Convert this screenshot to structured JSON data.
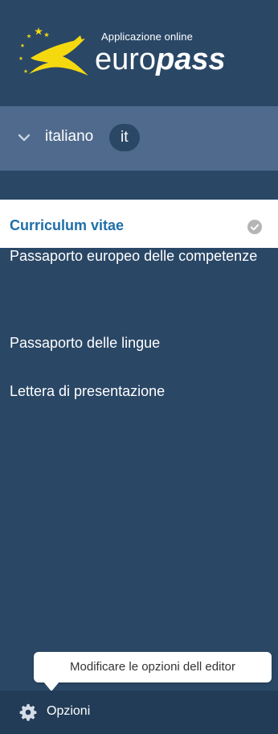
{
  "logo": {
    "subtitle": "Applicazione online",
    "name_light": "euro",
    "name_bold": "pass",
    "icon": "europass-logo"
  },
  "language": {
    "name": "italiano",
    "code": "it",
    "icon": "chevron-down-icon"
  },
  "menu": {
    "active": {
      "label": "Curriculum vitae",
      "status_icon": "check-circle-icon"
    },
    "items": [
      {
        "label": "Passaporto europeo delle competenze"
      },
      {
        "label": "Passaporto delle lingue"
      },
      {
        "label": "Lettera di presentazione"
      }
    ]
  },
  "footer": {
    "tooltip": "Modificare le opzioni dell editor",
    "options_label": "Opzioni",
    "icon": "gear-icon"
  },
  "colors": {
    "navy": "#2a4766",
    "lang_bar": "#4f6a8c",
    "active_text": "#1d6fa8",
    "footer": "#223c57"
  }
}
